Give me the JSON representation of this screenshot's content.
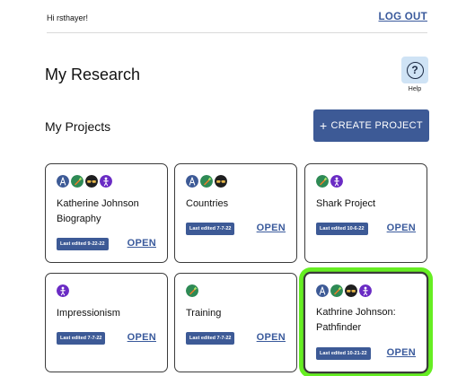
{
  "header": {
    "greeting": "Hi rsthayer!",
    "logout_label": "LOG OUT"
  },
  "page": {
    "title": "My Research",
    "help_label": "Help",
    "help_glyph": "?"
  },
  "projects": {
    "title": "My Projects",
    "create_label": "CREATE PROJECT",
    "create_glyph": "+",
    "open_label": "OPEN",
    "items": [
      {
        "title": "Katherine Johnson Biography",
        "edited": "Last edited 9-22-22",
        "icons": [
          "compass-icon",
          "carrot-icon",
          "glasses-icon",
          "figure-icon"
        ]
      },
      {
        "title": "Countries",
        "edited": "Last edited 7-7-22",
        "icons": [
          "compass-icon",
          "carrot-icon",
          "glasses-icon"
        ]
      },
      {
        "title": "Shark Project",
        "edited": "Last edited 10-6-22",
        "icons": [
          "carrot-icon",
          "figure-icon"
        ]
      },
      {
        "title": "Impressionism",
        "edited": "Last edited 7-7-22",
        "icons": [
          "figure-icon"
        ]
      },
      {
        "title": "Training",
        "edited": "Last edited 7-7-22",
        "icons": [
          "carrot-icon"
        ]
      },
      {
        "title": "Kathrine Johnson: Pathfinder",
        "edited": "Last edited 10-21-22",
        "icons": [
          "compass-icon",
          "carrot-icon",
          "glasses-icon",
          "figure-icon"
        ],
        "highlighted": true
      }
    ]
  },
  "colors": {
    "accent": "#3d5a96",
    "highlight": "#66ee22",
    "help_bg": "#cfe3f5"
  }
}
